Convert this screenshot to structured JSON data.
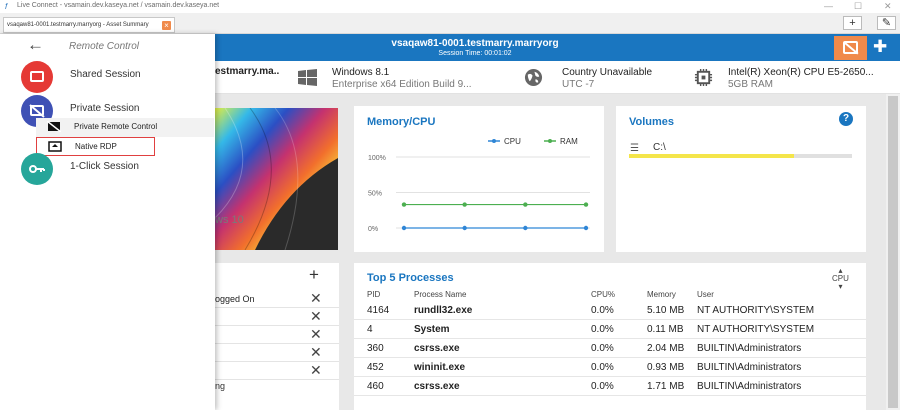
{
  "window": {
    "title": "Live Connect - vsamain.dev.kaseya.net / vsamain.dev.kaseya.net",
    "controls": {
      "minimize": "—",
      "maximize": "☐",
      "close": "✕"
    }
  },
  "tab": {
    "label": "vsaqaw81-0001.testmarry.marryorg - Asset Summary",
    "close": "×"
  },
  "tabstrip_buttons": {
    "add": "+",
    "edit": "✎"
  },
  "header": {
    "host": "vsaqaw81-0001.testmarry.marryorg",
    "session_time": "Session Time: 00:01:02"
  },
  "infobar": {
    "host_short": "estmarry.ma..",
    "os_name": "Windows 8.1",
    "os_edition": "Enterprise x64 Edition Build 9...",
    "country": "Country Unavailable",
    "timezone": "UTC -7",
    "cpu": "Intel(R) Xeon(R) CPU E5-2650...",
    "ram": "5GB RAM"
  },
  "wallpaper_watermark": "ws 10",
  "memcpu": {
    "title": "Memory/CPU",
    "legend": [
      {
        "label": "CPU",
        "color": "#2f86d6"
      },
      {
        "label": "RAM",
        "color": "#4caf50"
      }
    ],
    "y_labels": [
      "100%",
      "50%",
      "0%"
    ]
  },
  "chart_data": {
    "type": "line",
    "title": "Memory/CPU",
    "y_ticks": [
      "100%",
      "50%",
      "0%"
    ],
    "ylim": [
      0,
      100
    ],
    "grid": true,
    "series": [
      {
        "name": "CPU",
        "values": [
          0,
          0,
          0,
          0
        ],
        "color": "#2f86d6"
      },
      {
        "name": "RAM",
        "values": [
          33,
          33,
          33,
          33
        ],
        "color": "#4caf50"
      }
    ]
  },
  "volumes": {
    "title": "Volumes",
    "help": "?",
    "drive": "C:\\",
    "used_fraction": 0.74
  },
  "list_card": {
    "add": "+",
    "rows": [
      {
        "text": "ogged On"
      },
      {
        "text": ""
      },
      {
        "text": ""
      },
      {
        "text": ""
      },
      {
        "text": ""
      }
    ],
    "close": "✕",
    "tail": "ng"
  },
  "processes": {
    "title": "Top 5 Processes",
    "sort_label": "CPU",
    "headers": [
      "PID",
      "Process Name",
      "CPU%",
      "Memory",
      "User"
    ],
    "rows": [
      {
        "pid": "4164",
        "name": "rundll32.exe",
        "cpu": "0.0%",
        "mem": "5.10 MB",
        "user": "NT AUTHORITY\\SYSTEM"
      },
      {
        "pid": "4",
        "name": "System",
        "cpu": "0.0%",
        "mem": "0.11 MB",
        "user": "NT AUTHORITY\\SYSTEM"
      },
      {
        "pid": "360",
        "name": "csrss.exe",
        "cpu": "0.0%",
        "mem": "2.04 MB",
        "user": "BUILTIN\\Administrators"
      },
      {
        "pid": "452",
        "name": "wininit.exe",
        "cpu": "0.0%",
        "mem": "0.93 MB",
        "user": "BUILTIN\\Administrators"
      },
      {
        "pid": "460",
        "name": "csrss.exe",
        "cpu": "0.0%",
        "mem": "1.71 MB",
        "user": "BUILTIN\\Administrators"
      }
    ]
  },
  "side_panel": {
    "title": "Remote Control",
    "items": [
      {
        "label": "Shared Session",
        "color": "#e53935",
        "icon": "screen-icon"
      },
      {
        "label": "Private Session",
        "color": "#3f51b5",
        "icon": "screen-off-icon"
      },
      {
        "label": "1-Click Session",
        "color": "#26a69a",
        "icon": "key-icon"
      }
    ],
    "sub_items": [
      {
        "label": "Private Remote Control",
        "icon": "screen-off-icon"
      },
      {
        "label": "Native RDP",
        "icon": "upload-screen-icon"
      }
    ]
  }
}
